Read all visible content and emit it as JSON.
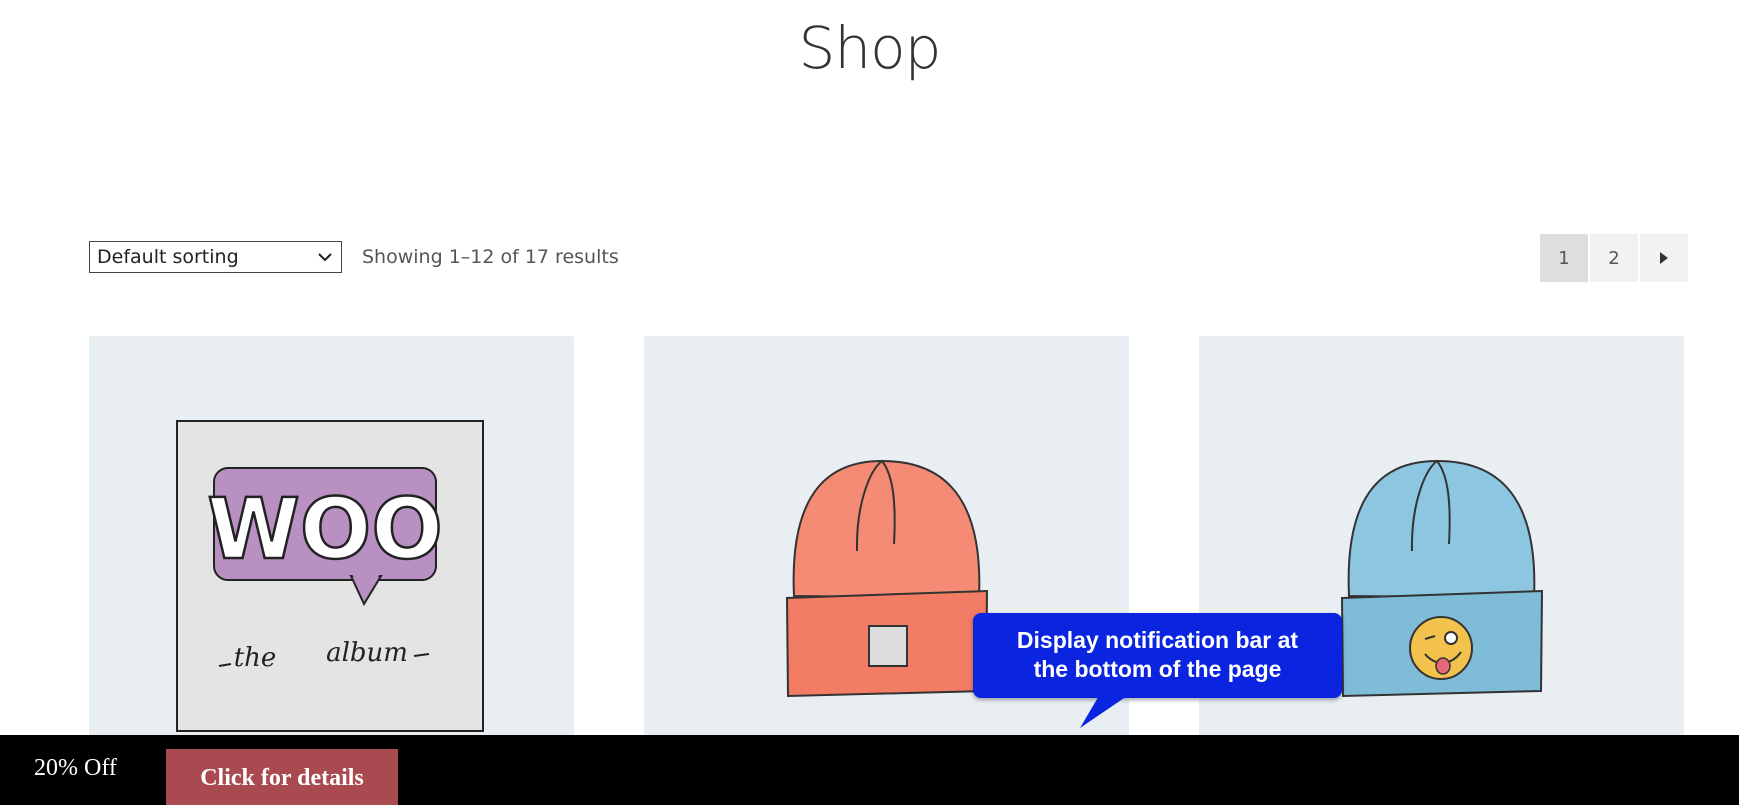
{
  "page": {
    "title": "Shop"
  },
  "toolbar": {
    "sort_selected": "Default sorting",
    "result_count": "Showing 1–12 of 17 results"
  },
  "pagination": {
    "pages": [
      "1",
      "2"
    ],
    "current": "1",
    "next_icon": "caret-right-icon"
  },
  "products": [
    {
      "image": "woo-album-cover",
      "image_text": [
        "WOO",
        "the",
        "album"
      ]
    },
    {
      "image": "orange-beanie"
    },
    {
      "image": "blue-beanie-with-winking-face"
    }
  ],
  "callout": {
    "line1": "Display notification bar at",
    "line2": "the bottom of the page",
    "color": "#0a24e0"
  },
  "notification_bar": {
    "text": "20% Off",
    "button_label": "Click for details",
    "bar_color": "#000000",
    "button_color": "#a84a4f"
  }
}
